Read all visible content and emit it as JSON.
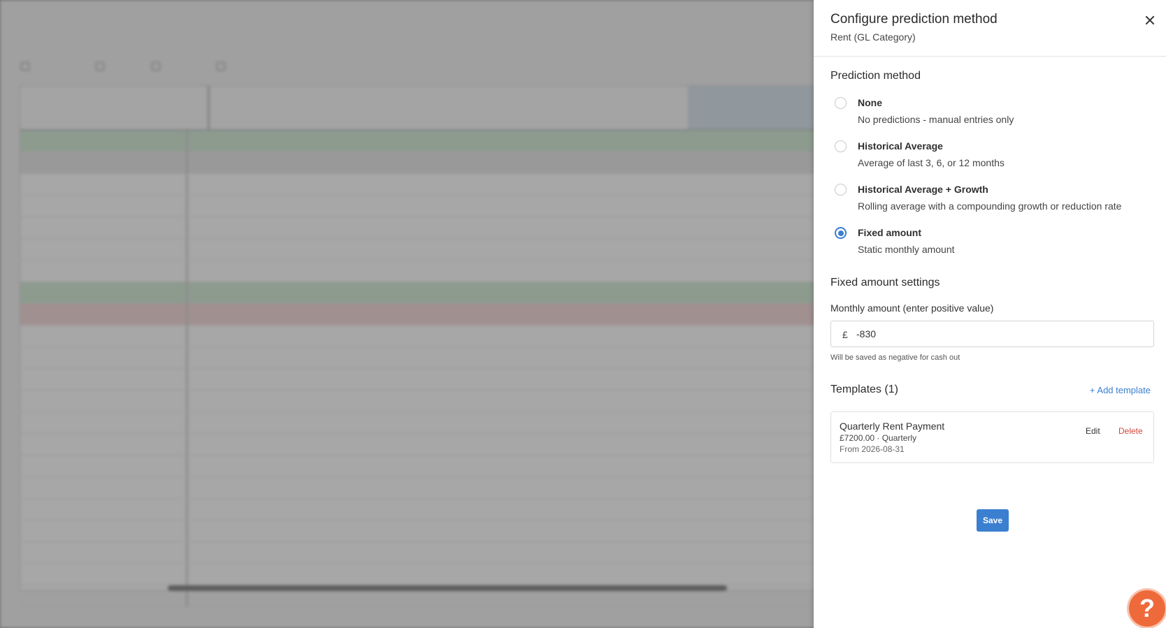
{
  "panel": {
    "title": "Configure prediction method",
    "subtitle": "Rent (GL Category)",
    "close_icon": "close-icon",
    "method_section_title": "Prediction method",
    "options": [
      {
        "label": "None",
        "description": "No predictions - manual entries only",
        "selected": false
      },
      {
        "label": "Historical Average",
        "description": "Average of last 3, 6, or 12 months",
        "selected": false
      },
      {
        "label": "Historical Average + Growth",
        "description": "Rolling average with a compounding growth or reduction rate",
        "selected": false
      },
      {
        "label": "Fixed amount",
        "description": "Static monthly amount",
        "selected": true
      }
    ],
    "fixed_settings_title": "Fixed amount settings",
    "amount_label": "Monthly amount (enter positive value)",
    "currency_symbol": "£",
    "amount_value": "-830",
    "amount_hint": "Will be saved as negative for cash out",
    "templates_title": "Templates (1)",
    "add_template_label": "+ Add template",
    "templates": [
      {
        "name": "Quarterly Rent Payment",
        "meta": "£7200.00 · Quarterly",
        "from": "From 2026-08-31",
        "edit_label": "Edit",
        "delete_label": "Delete"
      }
    ],
    "save_label": "Save"
  },
  "help_button": {
    "label": "?"
  },
  "colors": {
    "accent": "#3a7fd0",
    "danger": "#d0463c",
    "help": "#ef6a3a"
  }
}
